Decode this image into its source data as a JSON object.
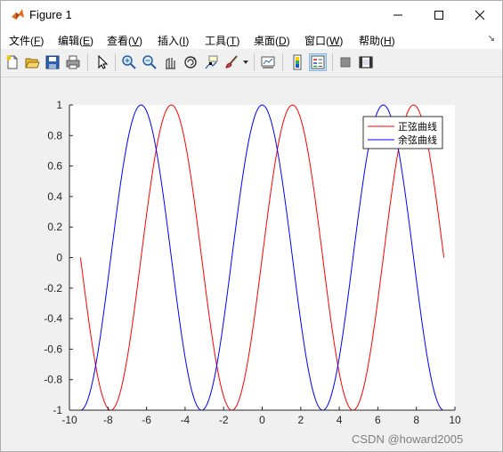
{
  "window": {
    "title": "Figure 1"
  },
  "menu": {
    "items": [
      {
        "text": "文件(",
        "key": "F",
        "end": ")"
      },
      {
        "text": "编辑(",
        "key": "E",
        "end": ")"
      },
      {
        "text": "查看(",
        "key": "V",
        "end": ")"
      },
      {
        "text": "插入(",
        "key": "I",
        "end": ")"
      },
      {
        "text": "工具(",
        "key": "T",
        "end": ")"
      },
      {
        "text": "桌面(",
        "key": "D",
        "end": ")"
      },
      {
        "text": "窗口(",
        "key": "W",
        "end": ")"
      },
      {
        "text": "帮助(",
        "key": "H",
        "end": ")"
      }
    ]
  },
  "toolbar": {
    "icons": [
      "new-figure-icon",
      "open-file-icon",
      "save-icon",
      "print-icon",
      "pointer-icon",
      "zoom-in-icon",
      "zoom-out-icon",
      "pan-icon",
      "rotate-3d-icon",
      "data-cursor-icon",
      "brush-icon",
      "link-plot-icon",
      "colorbar-icon",
      "legend-icon",
      "hide-plot-tools-icon",
      "show-plot-tools-icon"
    ]
  },
  "chart_data": {
    "type": "line",
    "xlim": [
      -10,
      10
    ],
    "ylim": [
      -1,
      1
    ],
    "x_range": [
      -9.4248,
      9.4248
    ],
    "xticks": [
      -10,
      -8,
      -6,
      -4,
      -2,
      0,
      2,
      4,
      6,
      8,
      10
    ],
    "yticks": [
      -1,
      -0.8,
      -0.6,
      -0.4,
      -0.2,
      0,
      0.2,
      0.4,
      0.6,
      0.8,
      1
    ],
    "legend_position": "top-right",
    "grid": false,
    "series": [
      {
        "name": "正弦曲线",
        "function": "sin(x)",
        "color": "#ff0000"
      },
      {
        "name": "余弦曲线",
        "function": "cos(x)",
        "color": "#0000ff"
      }
    ]
  },
  "watermark": "CSDN @howard2005"
}
